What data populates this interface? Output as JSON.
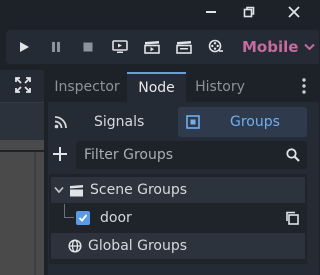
{
  "renderer": {
    "label": "Mobile"
  },
  "dock": {
    "tabs": [
      {
        "label": "Inspector",
        "active": false
      },
      {
        "label": "Node",
        "active": true
      },
      {
        "label": "History",
        "active": false
      }
    ]
  },
  "node_panel": {
    "signals_label": "Signals",
    "groups_label": "Groups",
    "active_mode": "Groups"
  },
  "filter": {
    "placeholder": "Filter Groups",
    "value": ""
  },
  "tree": {
    "scene_groups_label": "Scene Groups",
    "items": [
      {
        "label": "door",
        "checked": true
      }
    ],
    "global_groups_label": "Global Groups"
  },
  "colors": {
    "accent": "#6fb0f0",
    "renderer": "#c56ba0",
    "checkbox": "#5a9be4",
    "tab_active_border": "#6d9bd8"
  },
  "icons": {
    "window": [
      "minimize-icon",
      "restore-icon",
      "close-icon"
    ],
    "toolbar": [
      "play-icon",
      "pause-icon",
      "stop-icon",
      "remote-debug-icon",
      "play-scene-icon",
      "play-custom-scene-icon",
      "movie-maker-icon"
    ]
  }
}
